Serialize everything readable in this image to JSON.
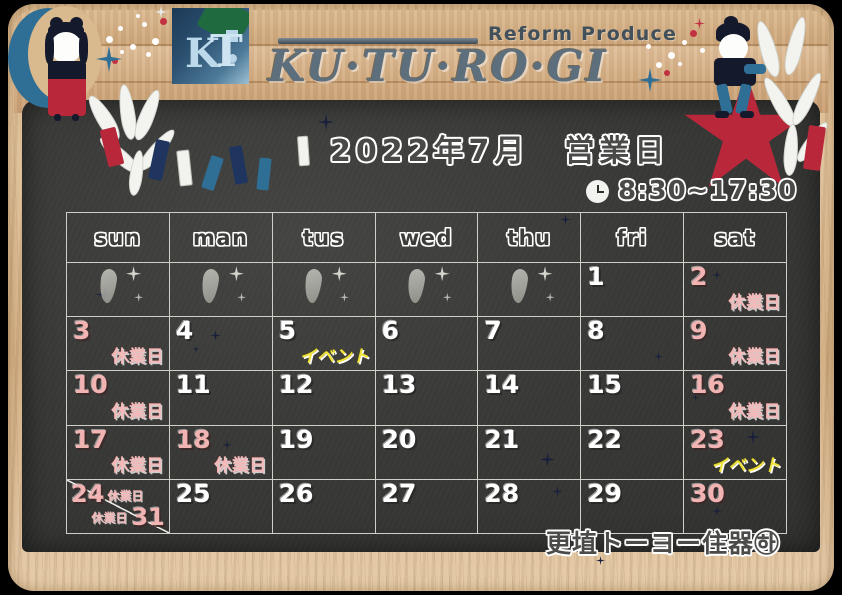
{
  "brand": {
    "reform_label": "Reform Produce",
    "name": "KU·TU·RO·GI",
    "logo_k": "K",
    "logo_t": "T"
  },
  "header": {
    "title": "2022年7月　営業日",
    "hours": "8:30~17:30",
    "clock_icon": "clock-icon"
  },
  "calendar": {
    "weekdays": [
      "sun",
      "man",
      "tus",
      "wed",
      "thu",
      "fri",
      "sat"
    ],
    "closed_label": "休業日",
    "event_label": "イベント",
    "weeks": [
      [
        {
          "day": "",
          "tag": "",
          "style": "empty"
        },
        {
          "day": "",
          "tag": "",
          "style": "empty"
        },
        {
          "day": "",
          "tag": "",
          "style": "empty"
        },
        {
          "day": "",
          "tag": "",
          "style": "empty"
        },
        {
          "day": "",
          "tag": "",
          "style": "empty"
        },
        {
          "day": "1",
          "tag": "",
          "style": "open"
        },
        {
          "day": "2",
          "tag": "休業日",
          "style": "closed"
        }
      ],
      [
        {
          "day": "3",
          "tag": "休業日",
          "style": "closed"
        },
        {
          "day": "4",
          "tag": "",
          "style": "open"
        },
        {
          "day": "5",
          "tag": "イベント",
          "style": "event"
        },
        {
          "day": "6",
          "tag": "",
          "style": "open"
        },
        {
          "day": "7",
          "tag": "",
          "style": "open"
        },
        {
          "day": "8",
          "tag": "",
          "style": "open"
        },
        {
          "day": "9",
          "tag": "休業日",
          "style": "closed"
        }
      ],
      [
        {
          "day": "10",
          "tag": "休業日",
          "style": "closed"
        },
        {
          "day": "11",
          "tag": "",
          "style": "open"
        },
        {
          "day": "12",
          "tag": "",
          "style": "open"
        },
        {
          "day": "13",
          "tag": "",
          "style": "open"
        },
        {
          "day": "14",
          "tag": "",
          "style": "open"
        },
        {
          "day": "15",
          "tag": "",
          "style": "open"
        },
        {
          "day": "16",
          "tag": "休業日",
          "style": "closed"
        }
      ],
      [
        {
          "day": "17",
          "tag": "休業日",
          "style": "closed"
        },
        {
          "day": "18",
          "tag": "休業日",
          "style": "closed"
        },
        {
          "day": "19",
          "tag": "",
          "style": "open"
        },
        {
          "day": "20",
          "tag": "",
          "style": "open"
        },
        {
          "day": "21",
          "tag": "",
          "style": "open"
        },
        {
          "day": "22",
          "tag": "",
          "style": "open"
        },
        {
          "day": "23",
          "tag": "イベント",
          "style": "event"
        }
      ],
      [
        {
          "day": "24",
          "tag": "休業日",
          "style": "split",
          "day2": "31",
          "tag2": "休業日"
        },
        {
          "day": "25",
          "tag": "",
          "style": "open"
        },
        {
          "day": "26",
          "tag": "",
          "style": "open"
        },
        {
          "day": "27",
          "tag": "",
          "style": "open"
        },
        {
          "day": "28",
          "tag": "",
          "style": "open"
        },
        {
          "day": "29",
          "tag": "",
          "style": "open"
        },
        {
          "day": "30",
          "tag": "",
          "style": "closed-num"
        }
      ]
    ]
  },
  "footer": {
    "company": "更埴トーヨー住器㉻"
  },
  "colors": {
    "board": "#3a3a38",
    "wood": "#d8b78c",
    "closed_pink": "#f2b3b3",
    "event_yellow": "#efe23a",
    "moon_blue": "#2f6f95",
    "star_red": "#b8283a",
    "navy": "#141a2c"
  }
}
